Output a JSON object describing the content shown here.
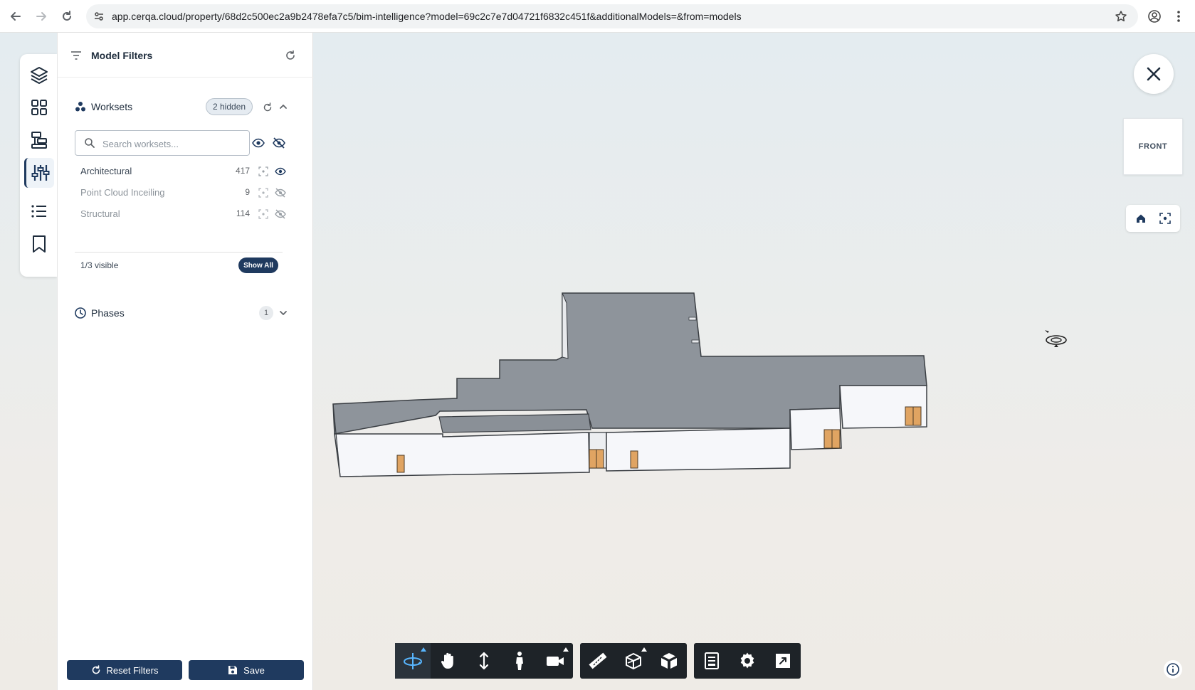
{
  "browser": {
    "url": "app.cerqa.cloud/property/68d2c500ec2a9b2478efa7c5/bim-intelligence?model=69c2c7e7d04721f6832c451f&additionalModels=&from=models"
  },
  "panel": {
    "title": "Model Filters",
    "worksets": {
      "title": "Worksets",
      "hidden_badge": "2 hidden",
      "search_placeholder": "Search worksets...",
      "items": [
        {
          "name": "Architectural",
          "count": "417",
          "visible": true
        },
        {
          "name": "Point Cloud Inceiling",
          "count": "9",
          "visible": false
        },
        {
          "name": "Structural",
          "count": "114",
          "visible": false
        }
      ],
      "visible_summary": "1/3 visible",
      "show_all_label": "Show All"
    },
    "phases": {
      "title": "Phases",
      "count": "1"
    },
    "footer": {
      "reset_label": "Reset Filters",
      "save_label": "Save"
    }
  },
  "viewer": {
    "view_cube_label": "FRONT"
  },
  "toolbar": {
    "groups": [
      [
        "orbit",
        "pan",
        "zoom",
        "first-person",
        "camera"
      ],
      [
        "measure",
        "section",
        "explode"
      ],
      [
        "properties",
        "settings",
        "fullscreen"
      ]
    ]
  },
  "colors": {
    "primary": "#1f3a5f",
    "toolbar_bg": "#1e2328",
    "active_tool": "#58b6ff",
    "roof": "#8e949b",
    "walls": "#f6f7fa",
    "doors": "#e0a462"
  }
}
